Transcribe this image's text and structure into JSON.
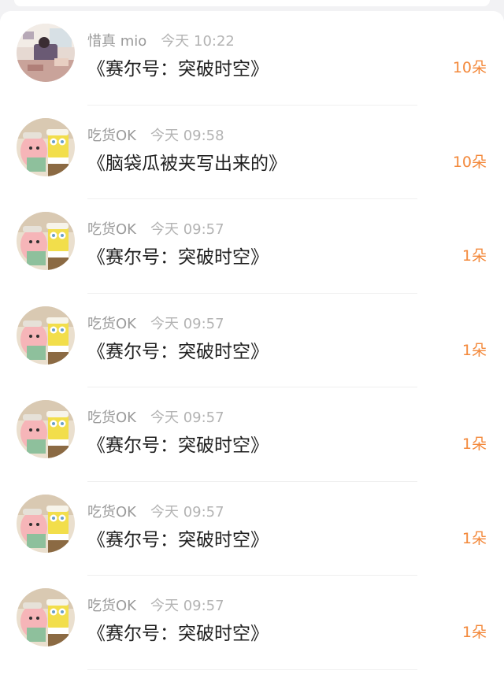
{
  "items": [
    {
      "name": "惜真 mio",
      "time": "今天 10:22",
      "title": "《赛尔号：突破时空》",
      "count": "10朵",
      "avatar": "girl-room-avatar"
    },
    {
      "name": "吃货OK",
      "time": "今天 09:58",
      "title": "《脑袋瓜被夹写出来的》",
      "count": "10朵",
      "avatar": "cartoon-avatar"
    },
    {
      "name": "吃货OK",
      "time": "今天 09:57",
      "title": "《赛尔号：突破时空》",
      "count": "1朵",
      "avatar": "cartoon-avatar"
    },
    {
      "name": "吃货OK",
      "time": "今天 09:57",
      "title": "《赛尔号：突破时空》",
      "count": "1朵",
      "avatar": "cartoon-avatar"
    },
    {
      "name": "吃货OK",
      "time": "今天 09:57",
      "title": "《赛尔号：突破时空》",
      "count": "1朵",
      "avatar": "cartoon-avatar"
    },
    {
      "name": "吃货OK",
      "time": "今天 09:57",
      "title": "《赛尔号：突破时空》",
      "count": "1朵",
      "avatar": "cartoon-avatar"
    },
    {
      "name": "吃货OK",
      "time": "今天 09:57",
      "title": "《赛尔号：突破时空》",
      "count": "1朵",
      "avatar": "cartoon-avatar"
    }
  ],
  "colors": {
    "accent": "#f3883a",
    "name": "#9a9a9a",
    "time": "#b3b3b3",
    "title": "#1f1f1f"
  }
}
